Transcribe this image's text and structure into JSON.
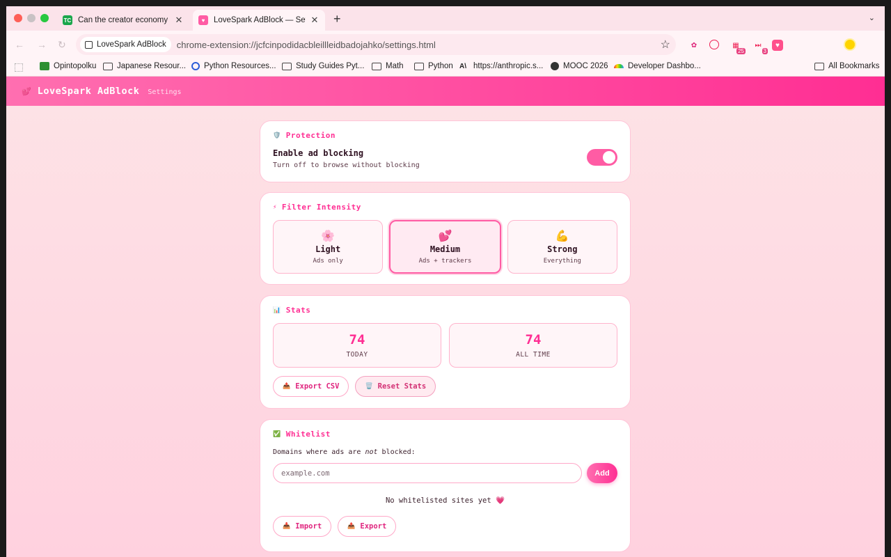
{
  "browser": {
    "tabs": [
      {
        "title": "Can the creator economy stay",
        "favicon": "TC"
      },
      {
        "title": "LoveSpark AdBlock — Settings"
      }
    ],
    "omnibox": {
      "chip": "LoveSpark AdBlock",
      "url": "chrome-extension://jcfcinpodidacbleillleidbadojahko/settings.html"
    },
    "extension_badges": {
      "calendar": "25",
      "media": "3"
    },
    "bookmarks": [
      {
        "label": "Opintopolku",
        "icon": "opintopolku-icon"
      },
      {
        "label": "Japanese Resour...",
        "icon": "folder-icon"
      },
      {
        "label": "Python Resources...",
        "icon": "c-logo-icon"
      },
      {
        "label": "Study Guides Pyt...",
        "icon": "folder-icon"
      },
      {
        "label": "Math",
        "icon": "folder-icon"
      },
      {
        "label": "Python",
        "icon": "folder-icon"
      },
      {
        "label": "https://anthropic.s...",
        "icon": "anthropic-icon"
      },
      {
        "label": "MOOC 2026",
        "icon": "globe-icon"
      },
      {
        "label": "Developer Dashbo...",
        "icon": "rainbow-icon"
      }
    ],
    "all_bookmarks": "All Bookmarks"
  },
  "header": {
    "brand": "LoveSpark AdBlock",
    "subtitle": "Settings"
  },
  "protection": {
    "title": "Protection",
    "toggle_title": "Enable ad blocking",
    "toggle_sub": "Turn off to browse without blocking",
    "enabled": true
  },
  "filter": {
    "title": "Filter Intensity",
    "options": [
      {
        "emoji": "🌸",
        "name": "Light",
        "desc": "Ads only"
      },
      {
        "emoji": "💕",
        "name": "Medium",
        "desc": "Ads + trackers"
      },
      {
        "emoji": "💪",
        "name": "Strong",
        "desc": "Everything"
      }
    ],
    "selected": "Medium"
  },
  "stats": {
    "title": "Stats",
    "today": {
      "value": "74",
      "label": "TODAY"
    },
    "all_time": {
      "value": "74",
      "label": "ALL TIME"
    },
    "export_label": "Export CSV",
    "reset_label": "Reset Stats"
  },
  "whitelist": {
    "title": "Whitelist",
    "desc_before": "Domains where ads are ",
    "desc_em": "not",
    "desc_after": " blocked:",
    "placeholder": "example.com",
    "add_label": "Add",
    "empty": "No whitelisted sites yet",
    "import_label": "Import",
    "export_label": "Export"
  },
  "colors": {
    "accent": "#ff2e93",
    "accent_light": "#ff6fb0",
    "card_border": "#ffc5d8"
  }
}
